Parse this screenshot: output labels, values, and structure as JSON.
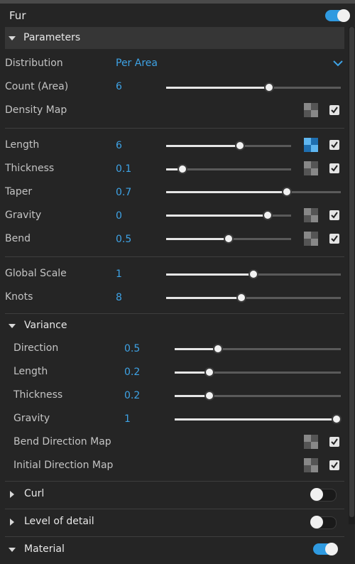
{
  "fur": {
    "title": "Fur",
    "enabled": true
  },
  "parameters": {
    "header": "Parameters",
    "distribution": {
      "label": "Distribution",
      "value": "Per Area"
    },
    "count": {
      "label": "Count (Area)",
      "value": "6",
      "level": 0.59
    },
    "density_map": {
      "label": "Density Map",
      "checked": true
    },
    "length": {
      "label": "Length",
      "value": "6",
      "level": 0.59,
      "map_active": true,
      "checked": true
    },
    "thickness": {
      "label": "Thickness",
      "value": "0.1",
      "level": 0.13,
      "checked": true
    },
    "taper": {
      "label": "Taper",
      "value": "0.7",
      "level": 0.69
    },
    "gravity": {
      "label": "Gravity",
      "value": "0",
      "level": 0.81,
      "checked": true
    },
    "bend": {
      "label": "Bend",
      "value": "0.5",
      "level": 0.5,
      "checked": true
    },
    "global_scale": {
      "label": "Global Scale",
      "value": "1",
      "level": 0.5
    },
    "knots": {
      "label": "Knots",
      "value": "8",
      "level": 0.43
    }
  },
  "variance": {
    "header": "Variance",
    "direction": {
      "label": "Direction",
      "value": "0.5",
      "level": 0.26
    },
    "length": {
      "label": "Length",
      "value": "0.2",
      "level": 0.21
    },
    "thickness": {
      "label": "Thickness",
      "value": "0.2",
      "level": 0.21
    },
    "gravity": {
      "label": "Gravity",
      "value": "1",
      "level": 1.0
    },
    "bend_direction_map": {
      "label": "Bend Direction Map",
      "checked": true
    },
    "initial_direction_map": {
      "label": "Initial Direction Map",
      "checked": true
    }
  },
  "curl": {
    "label": "Curl",
    "enabled": false
  },
  "level_of_detail": {
    "label": "Level of detail",
    "enabled": false
  },
  "material": {
    "label": "Material",
    "enabled": true
  },
  "colors": {
    "accent": "#2f9ae0",
    "value_text": "#3ea3e6",
    "background": "#252525"
  },
  "icons": {
    "dropdown": "chevron-down-icon",
    "map": "checker-map-icon",
    "expand": "triangle-down-icon",
    "collapse": "triangle-right-icon"
  }
}
